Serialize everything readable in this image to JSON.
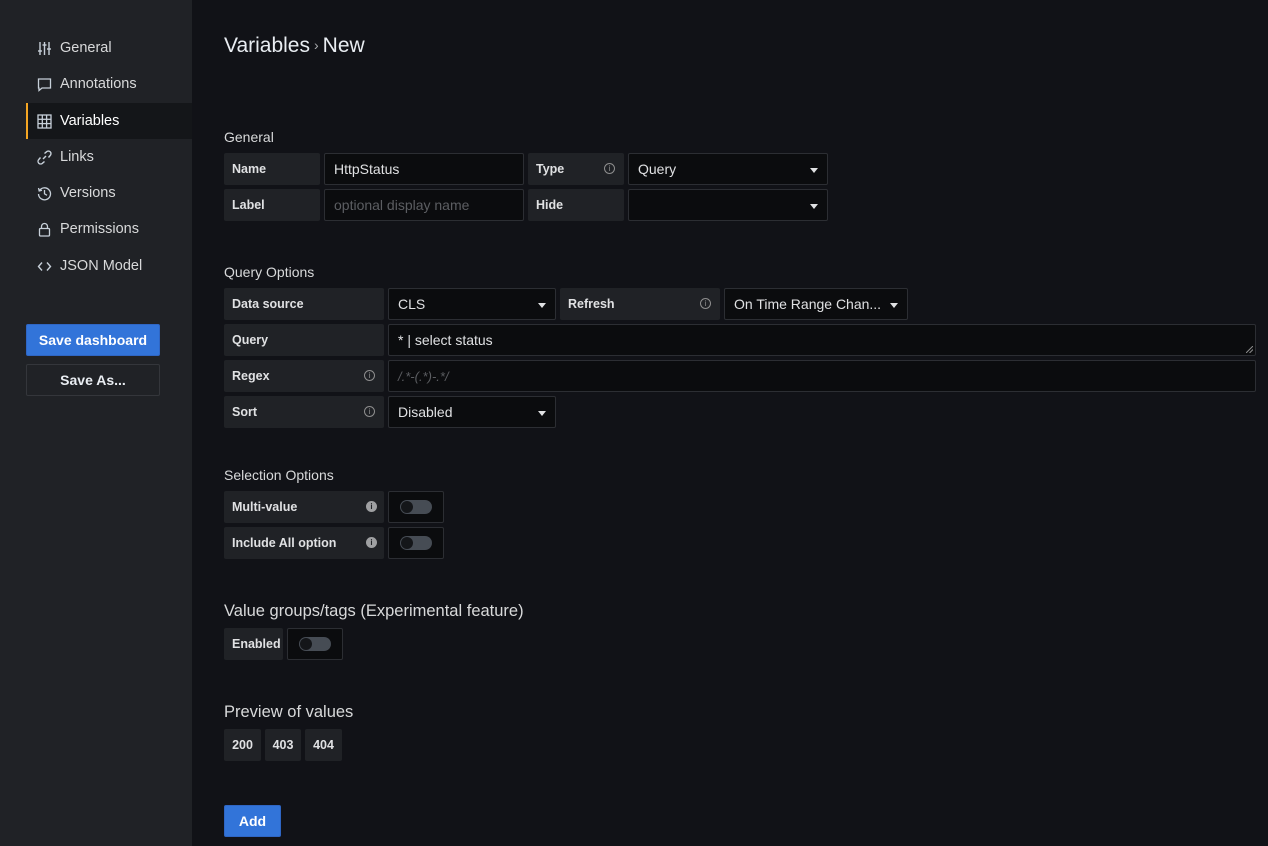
{
  "sidebar": {
    "items": [
      {
        "label": "General",
        "icon": "sliders-icon",
        "active": false
      },
      {
        "label": "Annotations",
        "icon": "comment-icon",
        "active": false
      },
      {
        "label": "Variables",
        "icon": "table-icon",
        "active": true
      },
      {
        "label": "Links",
        "icon": "link-icon",
        "active": false
      },
      {
        "label": "Versions",
        "icon": "history-icon",
        "active": false
      },
      {
        "label": "Permissions",
        "icon": "lock-icon",
        "active": false
      },
      {
        "label": "JSON Model",
        "icon": "code-icon",
        "active": false
      }
    ],
    "save_dashboard_label": "Save dashboard",
    "save_as_label": "Save As..."
  },
  "header": {
    "breadcrumb_parent": "Variables",
    "breadcrumb_separator": "›",
    "breadcrumb_current": "New"
  },
  "general": {
    "title": "General",
    "name_label": "Name",
    "name_value": "HttpStatus",
    "type_label": "Type",
    "type_value": "Query",
    "label_label": "Label",
    "label_placeholder": "optional display name",
    "hide_label": "Hide",
    "hide_value": ""
  },
  "query_options": {
    "title": "Query Options",
    "datasource_label": "Data source",
    "datasource_value": "CLS",
    "refresh_label": "Refresh",
    "refresh_value": "On Time Range Chan...",
    "query_label": "Query",
    "query_value": "* | select status",
    "regex_label": "Regex",
    "regex_placeholder": "/.*-(.*)-.*/",
    "sort_label": "Sort",
    "sort_value": "Disabled"
  },
  "selection_options": {
    "title": "Selection Options",
    "multi_value_label": "Multi-value",
    "multi_value_on": false,
    "include_all_label": "Include All option",
    "include_all_on": false
  },
  "value_groups": {
    "title": "Value groups/tags (Experimental feature)",
    "enabled_label": "Enabled",
    "enabled_on": false
  },
  "preview": {
    "title": "Preview of values",
    "values": [
      "200",
      "403",
      "404"
    ]
  },
  "add_label": "Add",
  "colors": {
    "primary": "#3274d9",
    "active_accent": "#f5a623",
    "sidebar_bg": "#202226",
    "page_bg": "#111217"
  }
}
